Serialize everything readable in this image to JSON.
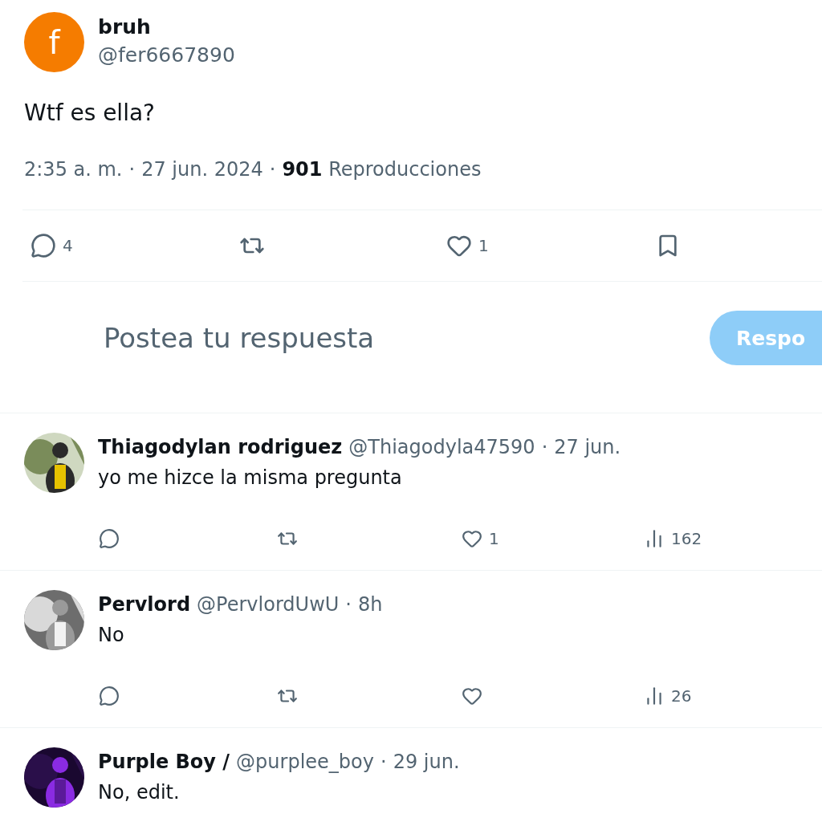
{
  "separator": "·",
  "post": {
    "author": {
      "name": "bruh",
      "handle": "@fer6667890",
      "avatar": {
        "letter": "f",
        "color": "#f57c00"
      }
    },
    "text": "Wtf es ella?",
    "time": "2:35 a. m.",
    "date": "27 jun. 2024",
    "views": "901",
    "views_label": "Reproducciones",
    "actions": [
      {
        "kind": "reply",
        "count": "4"
      },
      {
        "kind": "repost"
      },
      {
        "kind": "like",
        "count": "1"
      },
      {
        "kind": "bookmark"
      }
    ]
  },
  "composer": {
    "placeholder": "Postea tu respuesta",
    "button": "Respo",
    "disabled": true
  },
  "replies": [
    {
      "name": "Thiagodylan rodriguez",
      "handle": "@Thiagodyla47590",
      "time": "27 jun.",
      "text": "yo me hizce la misma pregunta",
      "actions": [
        {
          "kind": "reply"
        },
        {
          "kind": "repost"
        },
        {
          "kind": "like",
          "count": "1"
        },
        {
          "kind": "views",
          "count": "162"
        }
      ]
    },
    {
      "name": "Pervlord",
      "handle": "@PervlordUwU",
      "time": "8h",
      "text": "No",
      "actions": [
        {
          "kind": "reply"
        },
        {
          "kind": "repost"
        },
        {
          "kind": "like"
        },
        {
          "kind": "views",
          "count": "26"
        }
      ]
    },
    {
      "name": "Purple Boy /",
      "handle": "@purplee_boy",
      "time": "29 jun.",
      "text": "No, edit."
    }
  ]
}
